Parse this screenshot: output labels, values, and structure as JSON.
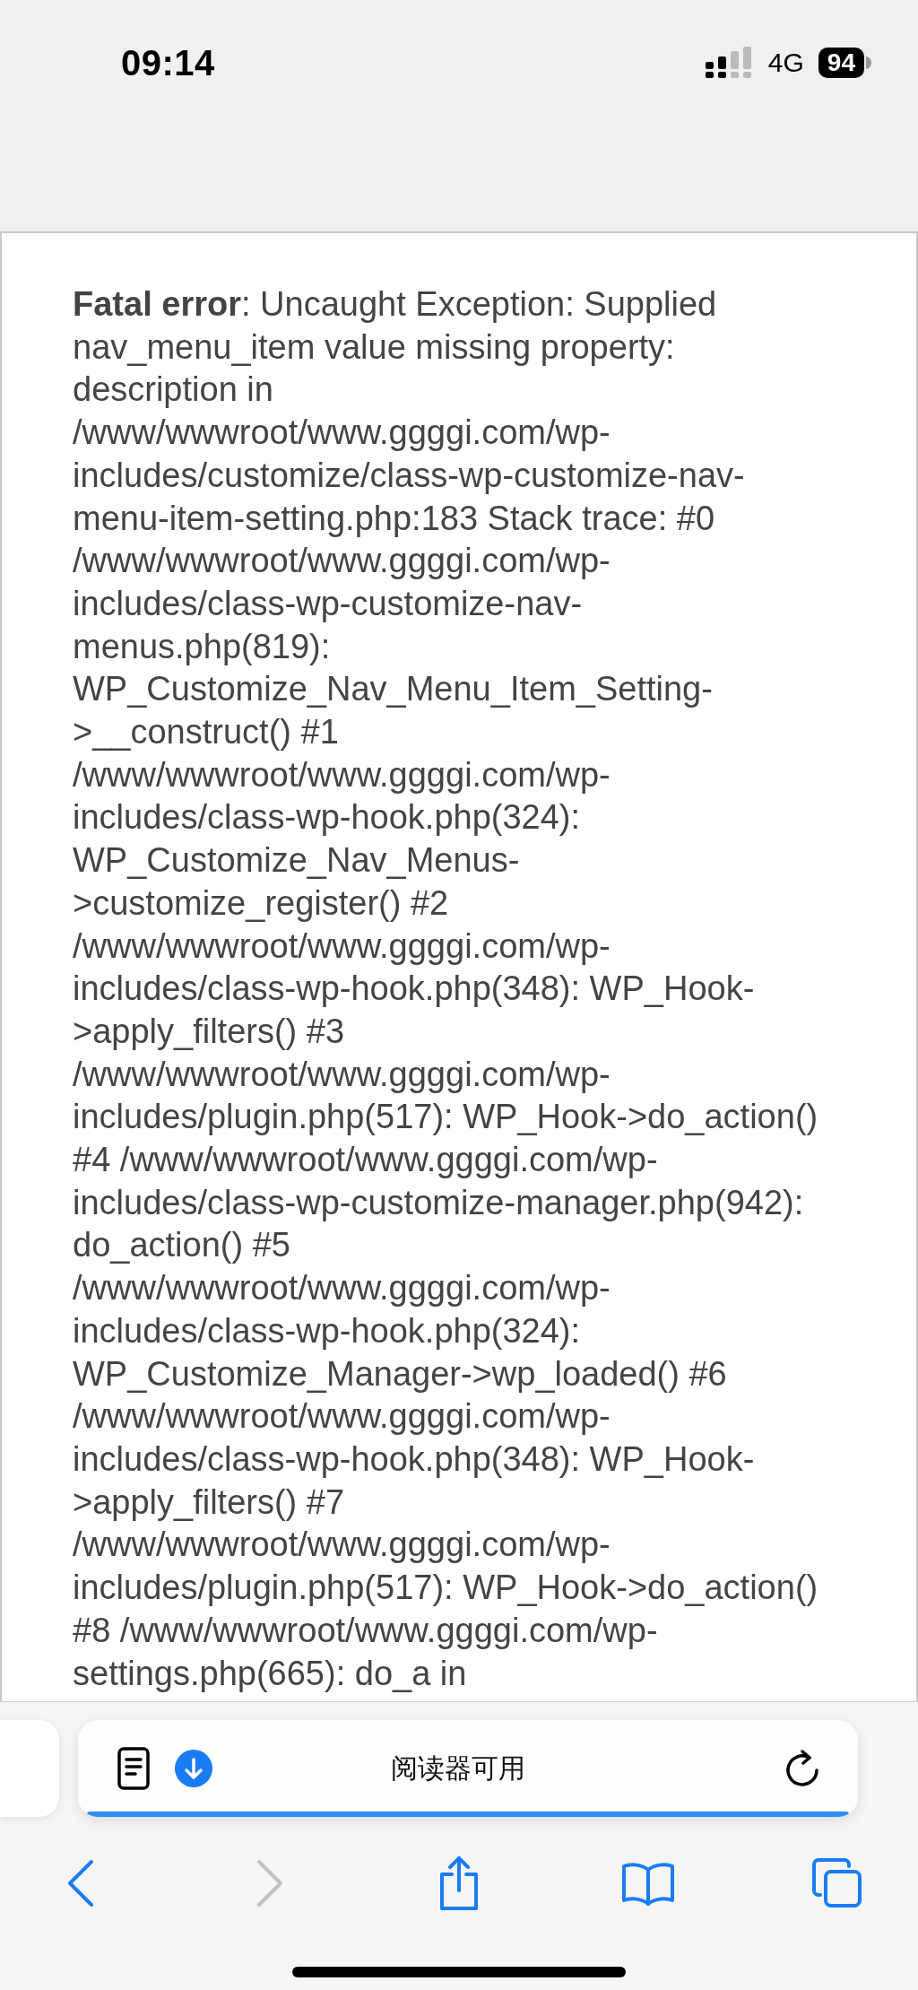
{
  "status_bar": {
    "time": "09:14",
    "network": "4G",
    "battery": "94"
  },
  "page": {
    "error_text": "**Fatal error**: Uncaught Exception: Supplied\nnav_menu_item value missing property:\ndescription in\n/www/wwwroot/www.ggggi.com/wp-\nincludes/customize/class-wp-customize-nav-\nmenu-item-setting.php:183 Stack trace: #0\n/www/wwwroot/www.ggggi.com/wp-\nincludes/class-wp-customize-nav-\nmenus.php(819):\nWP_Customize_Nav_Menu_Item_Setting-\n>__construct() #1\n/www/wwwroot/www.ggggi.com/wp-\nincludes/class-wp-hook.php(324):\nWP_Customize_Nav_Menus-\n>customize_register() #2\n/www/wwwroot/www.ggggi.com/wp-\nincludes/class-wp-hook.php(348): WP_Hook-\n>apply_filters() #3\n/www/wwwroot/www.ggggi.com/wp-\nincludes/plugin.php(517): WP_Hook->do_action()\n#4 /www/wwwroot/www.ggggi.com/wp-\nincludes/class-wp-customize-manager.php(942):\ndo_action() #5\n/www/wwwroot/www.ggggi.com/wp-\nincludes/class-wp-hook.php(324):\nWP_Customize_Manager->wp_loaded() #6\n/www/wwwroot/www.ggggi.com/wp-\nincludes/class-wp-hook.php(348): WP_Hook-\n>apply_filters() #7\n/www/wwwroot/www.ggggi.com/wp-\nincludes/plugin.php(517): WP_Hook->do_action()\n#8 /www/wwwroot/www.ggggi.com/wp-\nsettings.php(665): do_a in"
  },
  "address_bar": {
    "text": "阅读器可用"
  },
  "toolbar": [
    {
      "kind": "back",
      "disabled": false
    },
    {
      "kind": "forward",
      "disabled": true
    },
    {
      "kind": "share",
      "disabled": false
    },
    {
      "kind": "bookmarks",
      "disabled": false
    },
    {
      "kind": "tabs",
      "disabled": false
    }
  ]
}
